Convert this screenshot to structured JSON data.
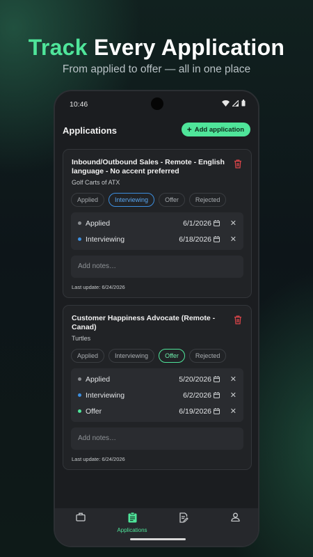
{
  "promo": {
    "headline_accent": "Track",
    "headline_rest": " Every Application",
    "subtitle": "From applied to offer — all in one place"
  },
  "status_bar": {
    "time": "10:46"
  },
  "header": {
    "title": "Applications",
    "add_label": "Add application"
  },
  "stage_options": [
    "Applied",
    "Interviewing",
    "Offer",
    "Rejected"
  ],
  "notes_placeholder": "Add notes…",
  "cards": [
    {
      "title": "Inbound/Outbound Sales - Remote - English language - No accent preferred",
      "company": "Golf Carts of ATX",
      "selected_stage": "Interviewing",
      "stages": [
        {
          "label": "Applied",
          "date": "6/1/2026",
          "color": "#8a8d91"
        },
        {
          "label": "Interviewing",
          "date": "6/18/2026",
          "color": "#3d8fe0"
        }
      ],
      "notes": "",
      "last_update": "Last update: 6/24/2026"
    },
    {
      "title": "Customer Happiness Advocate (Remote - Canad)",
      "company": "Turtles",
      "selected_stage": "Offer",
      "stages": [
        {
          "label": "Applied",
          "date": "5/20/2026",
          "color": "#8a8d91"
        },
        {
          "label": "Interviewing",
          "date": "6/2/2026",
          "color": "#3d8fe0"
        },
        {
          "label": "Offer",
          "date": "6/19/2026",
          "color": "#4fe59a"
        }
      ],
      "notes": "",
      "last_update": "Last update: 6/24/2026"
    }
  ],
  "bottom_nav": {
    "items": [
      {
        "icon": "briefcase-icon",
        "label": ""
      },
      {
        "icon": "clipboard-icon",
        "label": "Applications",
        "active": true
      },
      {
        "icon": "edit-document-icon",
        "label": ""
      },
      {
        "icon": "person-icon",
        "label": ""
      }
    ]
  },
  "colors": {
    "accent": "#4fe59a",
    "danger": "#e0464a",
    "interview": "#3d8fe0"
  }
}
